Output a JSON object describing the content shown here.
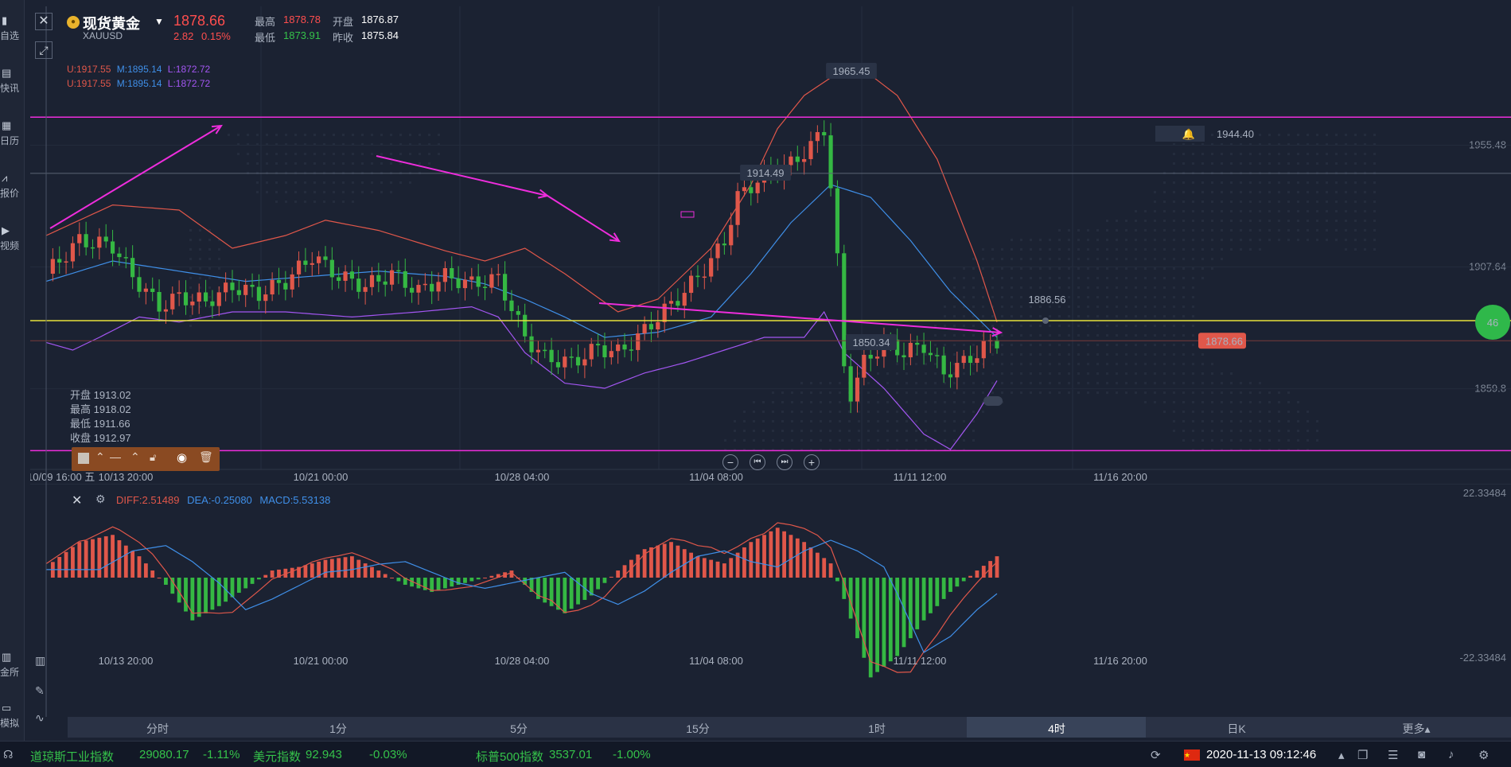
{
  "sidebar": {
    "items": [
      {
        "label": "自选",
        "icon": "bookmark-icon"
      },
      {
        "label": "快讯",
        "icon": "news-icon"
      },
      {
        "label": "日历",
        "icon": "calendar-icon"
      },
      {
        "label": "报价",
        "icon": "trend-icon"
      },
      {
        "label": "视频",
        "icon": "play-icon"
      }
    ],
    "bottom_items": [
      {
        "label": "金所",
        "icon": "exchange-icon"
      },
      {
        "label": "模拟",
        "icon": "wallet-icon"
      }
    ]
  },
  "header": {
    "symbol_name": "现货黄金",
    "symbol_code": "XAUUSD",
    "last_price": "1878.66",
    "change": "2.82",
    "change_pct": "0.15%",
    "high_label": "最高",
    "high_value": "1878.78",
    "open_label": "开盘",
    "open_value": "1876.87",
    "low_label": "最低",
    "low_value": "1873.91",
    "prev_close_label": "昨收",
    "prev_close_value": "1875.84"
  },
  "bollinger": {
    "line1": {
      "u": "U:1917.55",
      "m": "M:1895.14",
      "l": "L:1872.72"
    },
    "line2": {
      "u": "U:1917.55",
      "m": "M:1895.14",
      "l": "L:1872.72"
    }
  },
  "ohlc_tooltip": {
    "open": "开盘 1913.02",
    "high": "最高 1918.02",
    "low": "最低 1911.66",
    "close": "收盘 1912.97"
  },
  "price_axis": {
    "ticks": [
      "1955.48",
      "1907.64",
      "1859.8"
    ],
    "alert_price": "1944.40",
    "current_price": "1878.66",
    "hover_price": "1886.56",
    "side_badge": "46"
  },
  "annotations": {
    "peak": "1965.45",
    "mid": "1914.49",
    "low": "1850.34"
  },
  "time_axis": {
    "cursor_label": "10/09 16:00 五",
    "labels": [
      "10/13 20:00",
      "10/21 00:00",
      "10/28 04:00",
      "11/04 08:00",
      "11/11 12:00",
      "11/16 20:00"
    ]
  },
  "macd": {
    "diff": "DIFF:2.51489",
    "dea": "DEA:-0.25080",
    "macd": "MACD:5.53138",
    "top_value": "22.33484",
    "bottom_value": "-22.33484"
  },
  "timeframes": {
    "items": [
      "分时",
      "1分",
      "5分",
      "15分",
      "1时",
      "4时",
      "日K",
      "更多"
    ],
    "active": "4时"
  },
  "ticker": {
    "items": [
      {
        "name": "道琼斯工业指数",
        "value": "29080.17",
        "change": "-1.11%"
      },
      {
        "name": "美元指数",
        "value": "92.943",
        "change": "-0.03%"
      },
      {
        "name": "标普500指数",
        "value": "3537.01",
        "change": "-1.00%"
      }
    ],
    "datetime": "2020-11-13 09:12:46"
  },
  "colors": {
    "up": "#e0574a",
    "down": "#35b843",
    "boll_upper": "#e0574a",
    "boll_mid": "#3f8fe8",
    "boll_lower": "#a356f2",
    "magenta": "#ee2ddc",
    "yellow": "#e8e23a",
    "background": "#1b2232"
  },
  "chart_data": {
    "type": "candlestick",
    "instrument": "XAUUSD",
    "timeframe": "4时",
    "x_labels": [
      "10/13 20:00",
      "10/21 00:00",
      "10/28 04:00",
      "11/04 08:00",
      "11/11 12:00",
      "11/16 20:00"
    ],
    "ylim": [
      1835,
      1985
    ],
    "key_levels": {
      "resistance": 1966.5,
      "horizontal_yellow": 1886.56,
      "support": 1835.5,
      "alert": 1944.4,
      "current": 1878.66
    },
    "close_path": [
      [
        0,
        1905
      ],
      [
        5,
        1918
      ],
      [
        10,
        1916
      ],
      [
        13,
        1904
      ],
      [
        17,
        1892
      ],
      [
        20,
        1896
      ],
      [
        24,
        1894
      ],
      [
        28,
        1900
      ],
      [
        32,
        1897
      ],
      [
        36,
        1902
      ],
      [
        40,
        1912
      ],
      [
        44,
        1904
      ],
      [
        48,
        1900
      ],
      [
        52,
        1905
      ],
      [
        56,
        1898
      ],
      [
        60,
        1904
      ],
      [
        64,
        1901
      ],
      [
        68,
        1903
      ],
      [
        72,
        1880
      ],
      [
        75,
        1872
      ],
      [
        79,
        1870
      ],
      [
        83,
        1876
      ],
      [
        86,
        1874
      ],
      [
        89,
        1880
      ],
      [
        92,
        1888
      ],
      [
        96,
        1898
      ],
      [
        100,
        1910
      ],
      [
        102,
        1918
      ],
      [
        104,
        1935
      ],
      [
        108,
        1944
      ],
      [
        112,
        1948
      ],
      [
        115,
        1955
      ],
      [
        117,
        1962
      ],
      [
        118,
        1940
      ],
      [
        119,
        1910
      ],
      [
        120,
        1868
      ],
      [
        121,
        1858
      ],
      [
        123,
        1870
      ],
      [
        126,
        1878
      ],
      [
        129,
        1874
      ],
      [
        132,
        1877
      ],
      [
        135,
        1866
      ],
      [
        138,
        1870
      ],
      [
        141,
        1876
      ],
      [
        143,
        1878.66
      ]
    ],
    "bollinger_upper": [
      [
        0,
        1920
      ],
      [
        10,
        1932
      ],
      [
        20,
        1930
      ],
      [
        28,
        1915
      ],
      [
        36,
        1920
      ],
      [
        42,
        1926
      ],
      [
        50,
        1922
      ],
      [
        60,
        1914
      ],
      [
        66,
        1910
      ],
      [
        72,
        1915
      ],
      [
        78,
        1905
      ],
      [
        86,
        1890
      ],
      [
        92,
        1895
      ],
      [
        100,
        1915
      ],
      [
        106,
        1940
      ],
      [
        110,
        1962
      ],
      [
        114,
        1975
      ],
      [
        118,
        1982
      ],
      [
        124,
        1983
      ],
      [
        128,
        1975
      ],
      [
        134,
        1950
      ],
      [
        140,
        1910
      ],
      [
        143,
        1886
      ]
    ],
    "bollinger_mid": [
      [
        0,
        1902
      ],
      [
        10,
        1910
      ],
      [
        20,
        1906
      ],
      [
        30,
        1902
      ],
      [
        40,
        1904
      ],
      [
        50,
        1906
      ],
      [
        60,
        1904
      ],
      [
        66,
        1901
      ],
      [
        72,
        1895
      ],
      [
        78,
        1888
      ],
      [
        84,
        1880
      ],
      [
        92,
        1882
      ],
      [
        100,
        1888
      ],
      [
        106,
        1905
      ],
      [
        112,
        1925
      ],
      [
        118,
        1940
      ],
      [
        124,
        1935
      ],
      [
        130,
        1918
      ],
      [
        136,
        1898
      ],
      [
        143,
        1880
      ]
    ],
    "bollinger_lower": [
      [
        0,
        1878
      ],
      [
        4,
        1875
      ],
      [
        8,
        1880
      ],
      [
        14,
        1888
      ],
      [
        20,
        1886
      ],
      [
        28,
        1890
      ],
      [
        36,
        1890
      ],
      [
        46,
        1888
      ],
      [
        56,
        1890
      ],
      [
        64,
        1892
      ],
      [
        68,
        1888
      ],
      [
        72,
        1874
      ],
      [
        78,
        1862
      ],
      [
        84,
        1860
      ],
      [
        90,
        1866
      ],
      [
        96,
        1870
      ],
      [
        102,
        1875
      ],
      [
        108,
        1880
      ],
      [
        114,
        1880
      ],
      [
        117,
        1890
      ],
      [
        120,
        1874
      ],
      [
        126,
        1860
      ],
      [
        132,
        1842
      ],
      [
        136,
        1836
      ],
      [
        140,
        1850
      ],
      [
        143,
        1863
      ]
    ],
    "macd_range": [
      -22.33484,
      22.33484
    ],
    "macd_histogram": [
      [
        0,
        3
      ],
      [
        5,
        10
      ],
      [
        10,
        12
      ],
      [
        14,
        6
      ],
      [
        18,
        -2
      ],
      [
        22,
        -12
      ],
      [
        26,
        -8
      ],
      [
        30,
        -3
      ],
      [
        34,
        2
      ],
      [
        38,
        3
      ],
      [
        42,
        5
      ],
      [
        46,
        6
      ],
      [
        50,
        2
      ],
      [
        54,
        -2
      ],
      [
        58,
        -4
      ],
      [
        62,
        -2
      ],
      [
        66,
        0
      ],
      [
        70,
        2
      ],
      [
        74,
        -6
      ],
      [
        78,
        -10
      ],
      [
        82,
        -5
      ],
      [
        86,
        2
      ],
      [
        90,
        8
      ],
      [
        94,
        10
      ],
      [
        98,
        6
      ],
      [
        102,
        4
      ],
      [
        106,
        10
      ],
      [
        110,
        14
      ],
      [
        114,
        10
      ],
      [
        118,
        4
      ],
      [
        120,
        -6
      ],
      [
        124,
        -28
      ],
      [
        128,
        -22
      ],
      [
        132,
        -12
      ],
      [
        136,
        -4
      ],
      [
        140,
        2
      ],
      [
        143,
        6
      ]
    ]
  }
}
